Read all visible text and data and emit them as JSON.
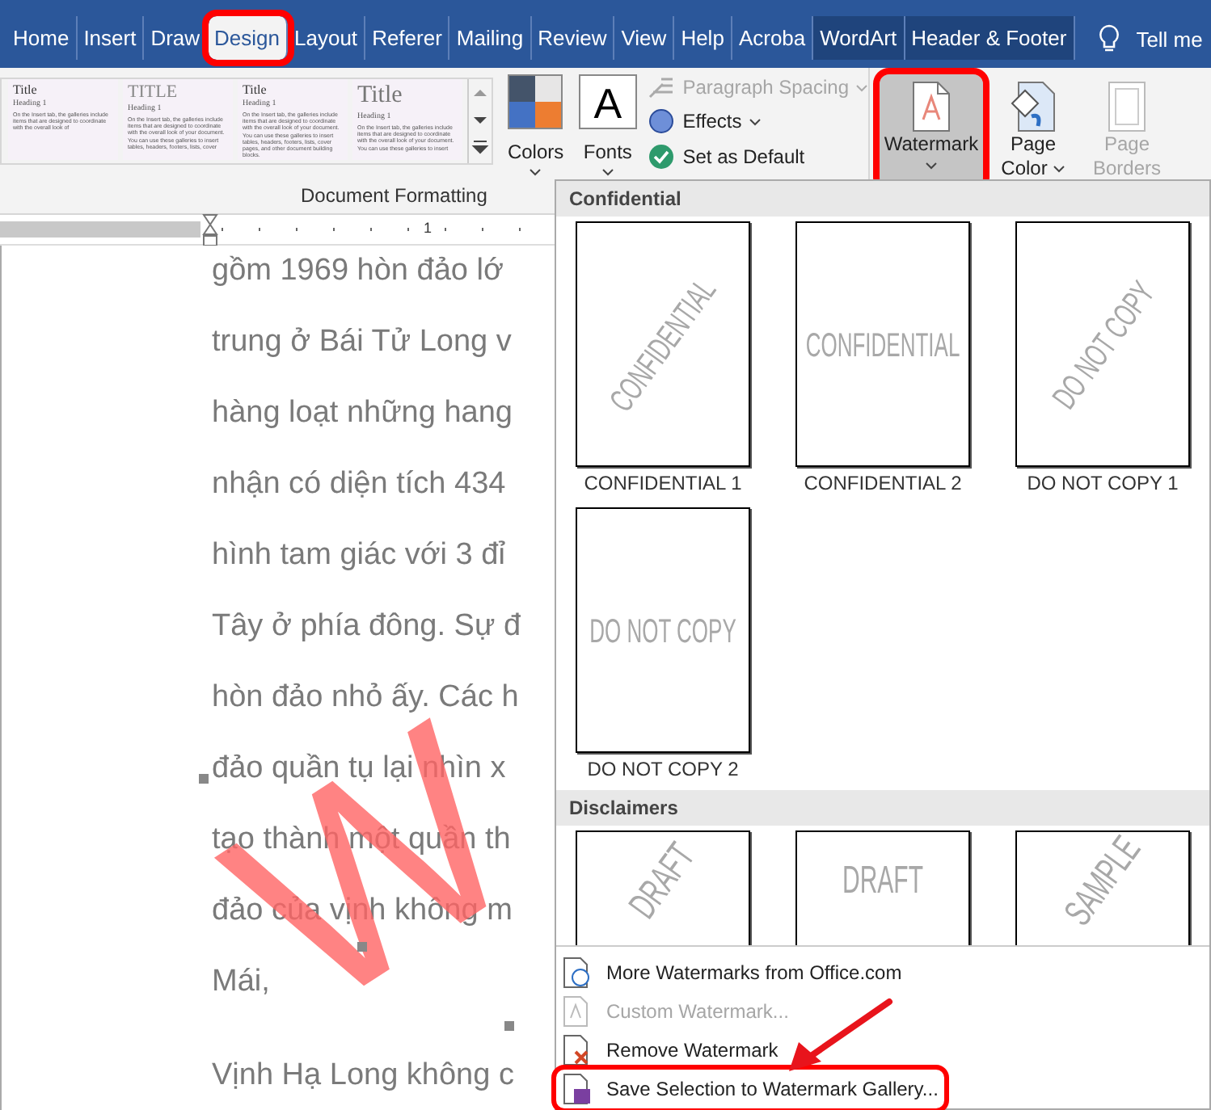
{
  "tabs": [
    {
      "label": "Home",
      "selected": false,
      "contextual": false,
      "highlighted": false
    },
    {
      "label": "Insert",
      "selected": false,
      "contextual": false,
      "highlighted": false
    },
    {
      "label": "Draw",
      "selected": false,
      "contextual": false,
      "highlighted": false
    },
    {
      "label": "Design",
      "selected": true,
      "contextual": false,
      "highlighted": true
    },
    {
      "label": "Layout",
      "selected": false,
      "contextual": false,
      "highlighted": false
    },
    {
      "label": "Referer",
      "selected": false,
      "contextual": false,
      "highlighted": false
    },
    {
      "label": "Mailing",
      "selected": false,
      "contextual": false,
      "highlighted": false
    },
    {
      "label": "Review",
      "selected": false,
      "contextual": false,
      "highlighted": false
    },
    {
      "label": "View",
      "selected": false,
      "contextual": false,
      "highlighted": false
    },
    {
      "label": "Help",
      "selected": false,
      "contextual": false,
      "highlighted": false
    },
    {
      "label": "Acroba",
      "selected": false,
      "contextual": false,
      "highlighted": false
    },
    {
      "label": "WordArt",
      "selected": false,
      "contextual": true,
      "highlighted": false
    },
    {
      "label": "Header & Footer",
      "selected": false,
      "contextual": true,
      "highlighted": false
    }
  ],
  "tell_me": "Tell me",
  "style_gallery": [
    {
      "kind": "plain",
      "title": "Title",
      "heading": "Heading 1",
      "body": "On the Insert tab, the galleries include items that are designed to coordinate with the overall look of"
    },
    {
      "kind": "caps",
      "title": "TITLE",
      "heading": "Heading 1",
      "body": "On the Insert tab, the galleries include items that are designed to coordinate with the overall look of your document. You can use these galleries to insert tables, headers, footers, lists, cover"
    },
    {
      "kind": "plain",
      "title": "Title",
      "heading": "Heading 1",
      "body": "On the Insert tab, the galleries include items that are designed to coordinate with the overall look of your document. You can use these galleries to insert tables, headers, footers, lists, cover pages, and other document building blocks."
    },
    {
      "kind": "large",
      "title": "Title",
      "heading": "Heading 1",
      "body": "On the Insert tab, the galleries include items that are designed to coordinate with the overall look of your document. You can use these galleries to insert"
    }
  ],
  "colors": {
    "label": "Colors",
    "dropdown": true
  },
  "fonts": {
    "glyph": "A",
    "label": "Fonts",
    "dropdown": true
  },
  "format_options": [
    {
      "kind": "spacing",
      "label": "Paragraph Spacing",
      "disabled": true,
      "dropdown": true
    },
    {
      "kind": "effects",
      "label": "Effects",
      "disabled": false,
      "dropdown": true
    },
    {
      "kind": "default",
      "label": "Set as Default",
      "disabled": false,
      "dropdown": false
    }
  ],
  "group_label": "Document Formatting",
  "page_background": [
    {
      "kind": "watermark",
      "lines": [
        "Watermark"
      ],
      "active": true,
      "highlighted": true,
      "disabled": false,
      "dropdown": true
    },
    {
      "kind": "color",
      "lines": [
        "Page",
        "Color"
      ],
      "active": false,
      "highlighted": false,
      "disabled": false,
      "dropdown": true
    },
    {
      "kind": "borders",
      "lines": [
        "Page",
        "Borders"
      ],
      "active": false,
      "highlighted": false,
      "disabled": true,
      "dropdown": false
    }
  ],
  "ruler_label": "1",
  "document": {
    "lines": [
      "gồm 1969 hòn đảo lớ",
      "trung ở Bái Tử Long v",
      "hàng loạt những hang",
      "nhận có diện tích 434",
      "hình tam giác với 3 đỉ",
      "Tây ở phía đông. Sự đ",
      "hòn đảo nhỏ ấy. Các h",
      "đảo quần tụ lại nhìn x",
      "tạo thành một quần th",
      "đảo của vịnh không m",
      "Mái,",
      "Vịnh Hạ Long không c"
    ],
    "wordart": "W"
  },
  "watermark_menu": {
    "sections": [
      {
        "heading": "Confidential",
        "items": [
          {
            "label": "CONFIDENTIAL 1",
            "text": "CONFIDENTIAL",
            "diagonal": true
          },
          {
            "label": "CONFIDENTIAL 2",
            "text": "CONFIDENTIAL",
            "diagonal": false
          },
          {
            "label": "DO NOT COPY 1",
            "text": "DO NOT COPY",
            "diagonal": true
          },
          {
            "label": "DO NOT COPY 2",
            "text": "DO NOT COPY",
            "diagonal": false
          }
        ]
      },
      {
        "heading": "Disclaimers",
        "items": [
          {
            "text": "DRAFT",
            "diagonal": true
          },
          {
            "text": "DRAFT",
            "diagonal": false
          },
          {
            "text": "SAMPLE",
            "diagonal": true
          }
        ]
      }
    ],
    "commands": [
      {
        "kind": "more",
        "label": "More Watermarks from Office.com",
        "disabled": false,
        "highlighted": false
      },
      {
        "kind": "custom",
        "label": "Custom Watermark...",
        "disabled": true,
        "highlighted": false
      },
      {
        "kind": "remove",
        "label": "Remove Watermark",
        "disabled": false,
        "highlighted": false
      },
      {
        "kind": "save",
        "label": "Save Selection to Watermark Gallery...",
        "disabled": false,
        "highlighted": true
      }
    ]
  },
  "annotation_arrow": true
}
